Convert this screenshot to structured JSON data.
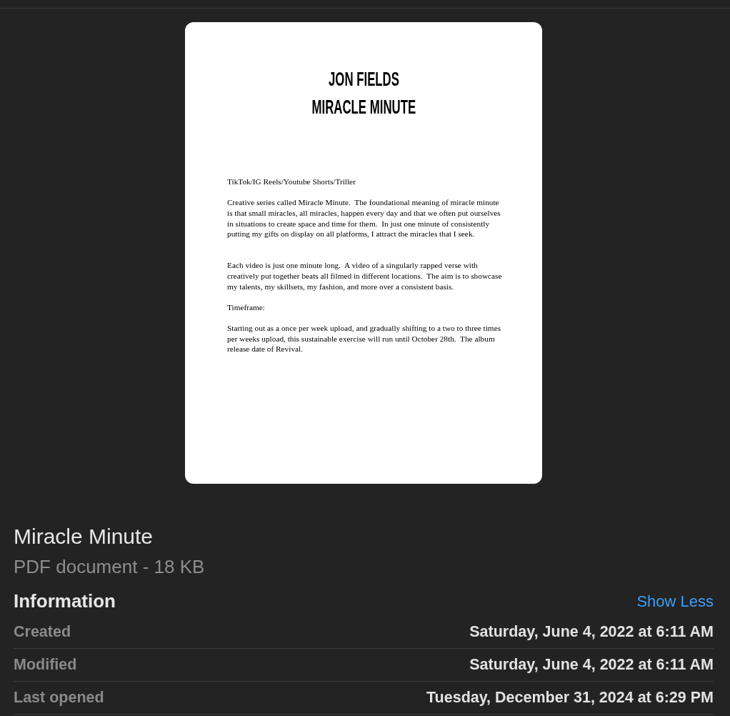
{
  "preview": {
    "heading": [
      "JON FIELDS",
      "MIRACLE MINUTE"
    ],
    "paragraphs": [
      "TikTok/IG Reels/Youtube Shorts/Triller",
      "Creative series called Miracle Minute.  The foundational meaning of miracle minute is that small miracles, all miracles, happen every day and that we often put ourselves in situations to create space and time for them.  In just one minute of consistently putting my gifts on display on all platforms, I attract the miracles that I seek.",
      "Each video is just one minute long.  A video of a singularly rapped verse with creatively put together beats all filmed in different locations.  The aim is to showcase my talents, my skillsets, my fashion, and more over a consistent basis.",
      "Timeframe:",
      "Starting out as a once per week upload, and gradually shifting to a two to three times per weeks upload, this sustainable exercise will run until October 28th.  The album release date of Revival."
    ]
  },
  "file": {
    "name": "Miracle Minute",
    "kind": "PDF document - 18 KB"
  },
  "information": {
    "title": "Information",
    "toggle": "Show Less",
    "rows": [
      {
        "label": "Created",
        "value": "Saturday, June 4, 2022 at 6:11 AM"
      },
      {
        "label": "Modified",
        "value": "Saturday, June 4, 2022 at 6:11 AM"
      },
      {
        "label": "Last opened",
        "value": "Tuesday, December 31, 2024 at 6:29 PM"
      }
    ]
  }
}
